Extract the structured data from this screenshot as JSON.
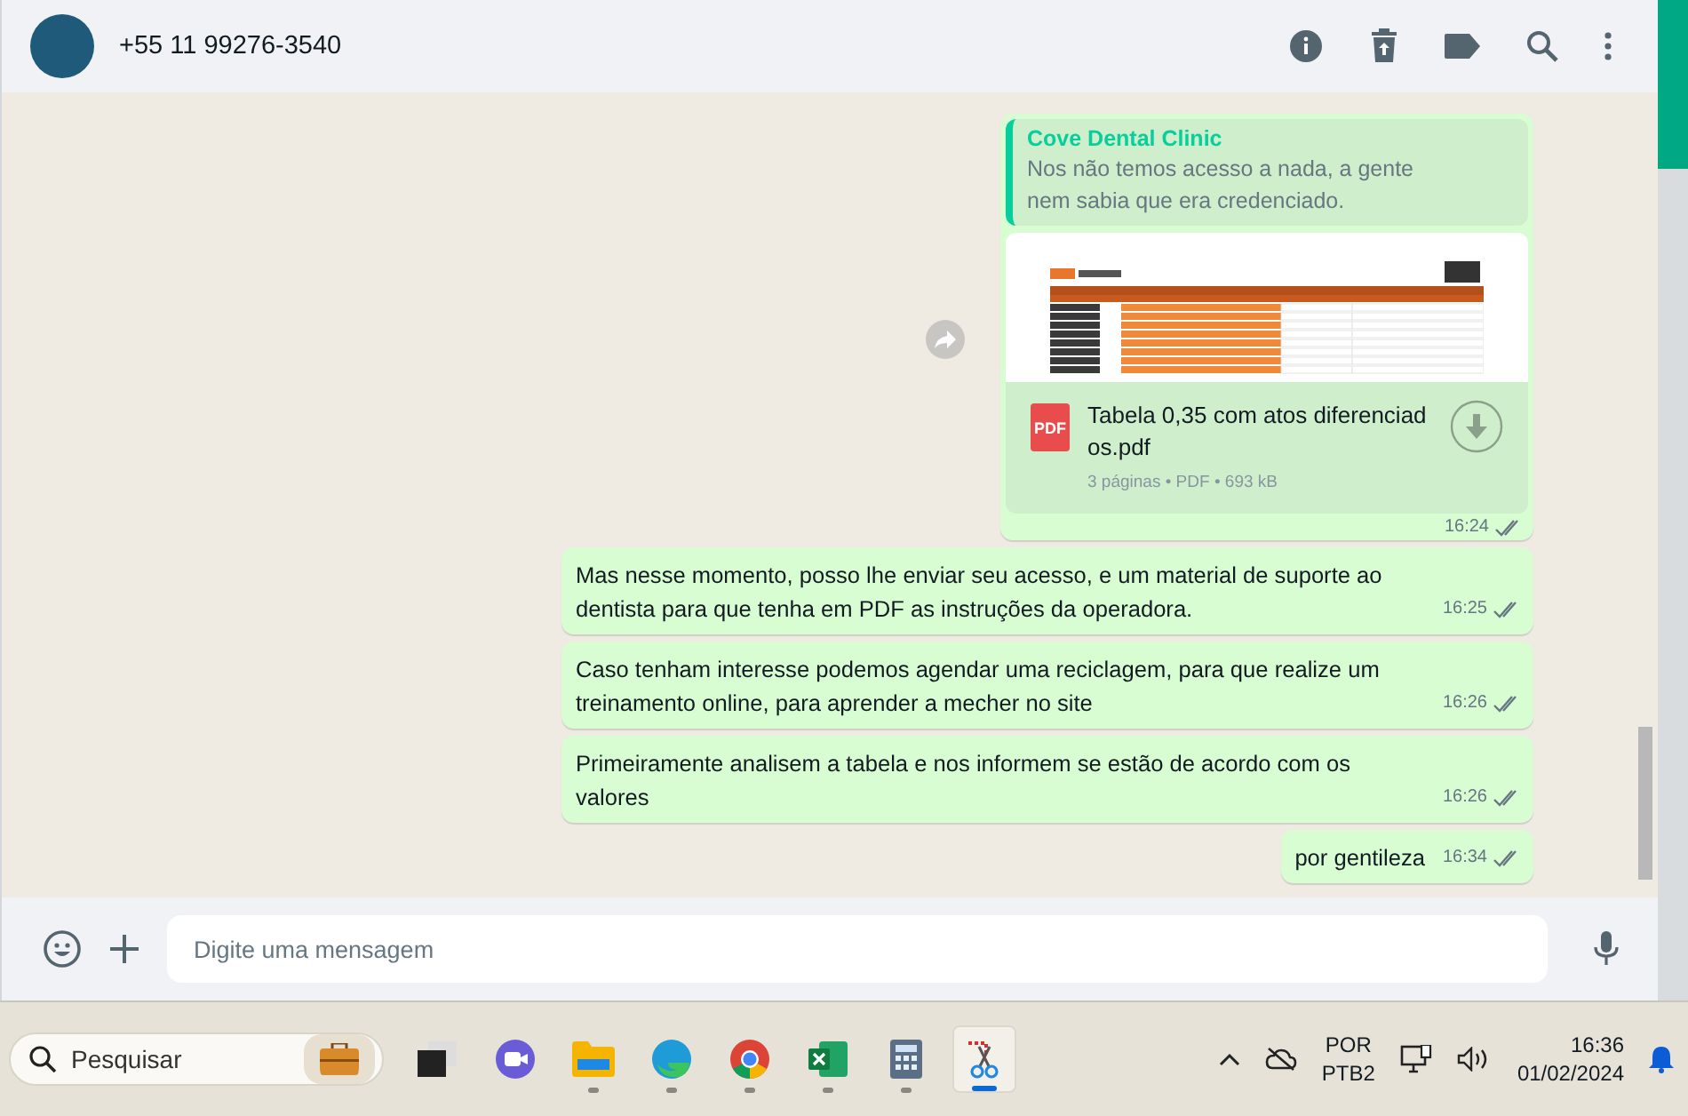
{
  "header": {
    "contact": "+55 11 99276-3540"
  },
  "messages": [
    {
      "kind": "document",
      "quote": {
        "author": "Cove Dental Clinic",
        "text": "Nos não temos acesso a nada, a gente nem sabia que era credenciado."
      },
      "file": {
        "name": "Tabela 0,35 com atos diferenciados.pdf",
        "badge": "PDF",
        "meta": "3 páginas • PDF • 693 kB"
      },
      "time": "16:24"
    },
    {
      "kind": "text",
      "text": "Mas nesse momento, posso lhe enviar seu acesso, e um material de suporte ao dentista para que tenha em PDF as instruções da operadora.",
      "time": "16:25"
    },
    {
      "kind": "text",
      "text": "Caso tenham interesse podemos agendar uma reciclagem, para que realize um treinamento online, para aprender a mecher no site",
      "time": "16:26"
    },
    {
      "kind": "text",
      "text": "Primeiramente analisem a tabela e nos informem se estão de acordo com os valores",
      "time": "16:26"
    },
    {
      "kind": "text",
      "text": "por gentileza",
      "time": "16:34"
    }
  ],
  "composer": {
    "placeholder": "Digite uma mensagem"
  },
  "taskbar": {
    "search_placeholder": "Pesquisar",
    "apps": [
      {
        "kind": "task-view",
        "running": false,
        "active": false
      },
      {
        "kind": "meeting",
        "running": false,
        "active": false
      },
      {
        "kind": "files",
        "running": true,
        "active": false
      },
      {
        "kind": "edge",
        "running": true,
        "active": false
      },
      {
        "kind": "chrome",
        "running": true,
        "active": false
      },
      {
        "kind": "excel",
        "running": true,
        "active": false
      },
      {
        "kind": "calculator",
        "running": true,
        "active": false
      },
      {
        "kind": "snipping",
        "running": true,
        "active": true
      }
    ],
    "language": "POR",
    "layout": "PTB2",
    "time": "16:36",
    "date": "01/02/2024"
  }
}
